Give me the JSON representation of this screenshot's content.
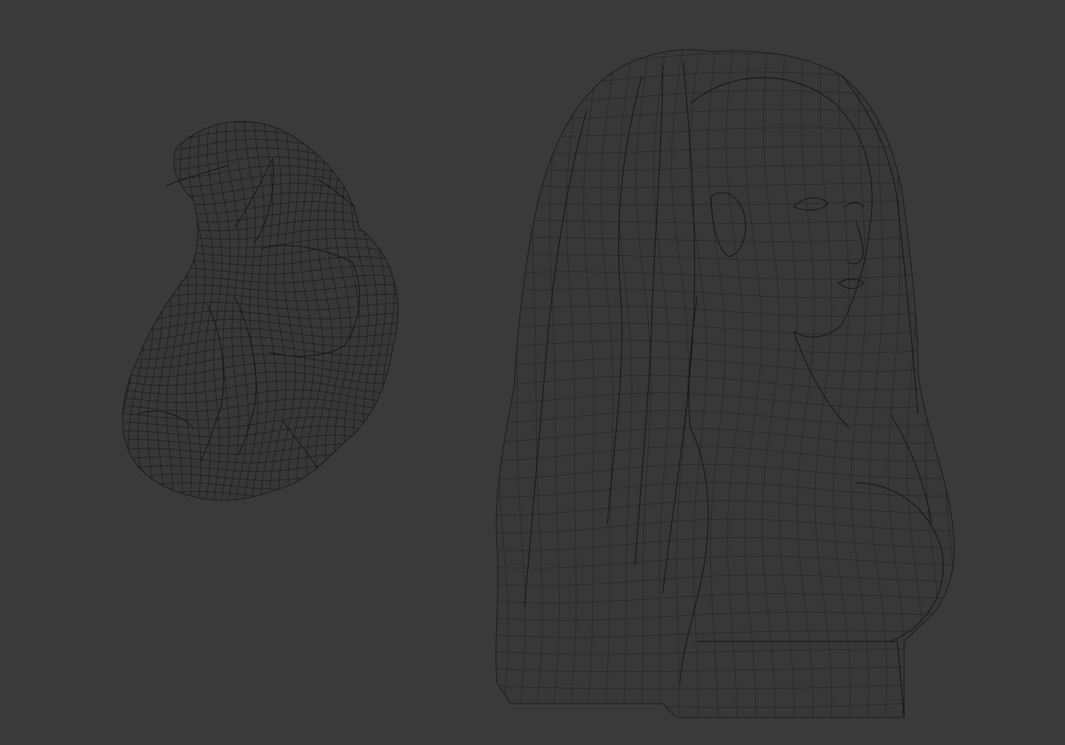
{
  "viewport": {
    "background_color": "#3a3a3a",
    "wire_color": "#1f1f1f"
  },
  "objects": [
    {
      "name": "hair-bun-mesh",
      "label": ""
    },
    {
      "name": "female-bust-mesh",
      "label": ""
    }
  ]
}
